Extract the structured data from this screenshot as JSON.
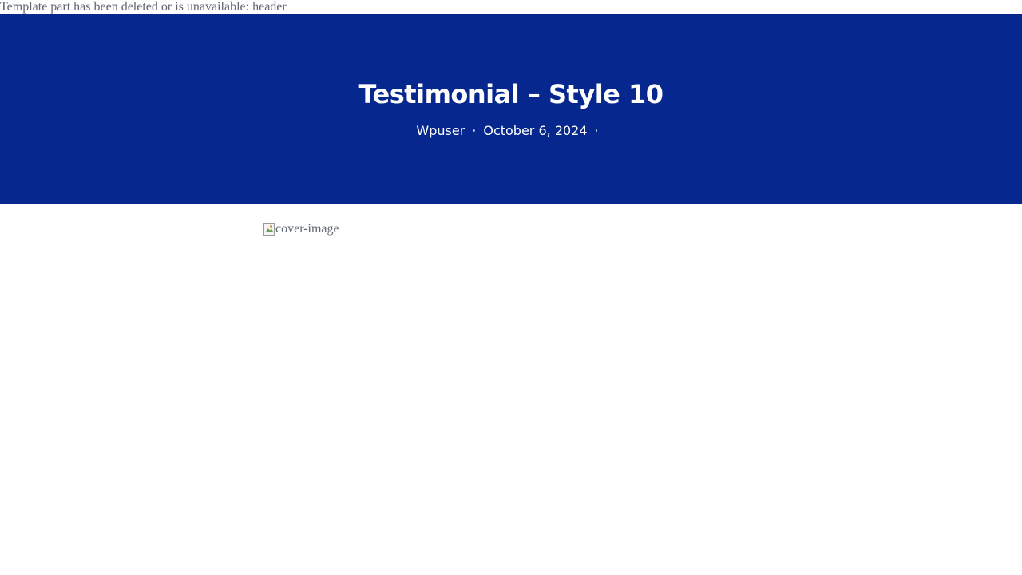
{
  "notice": {
    "text": "Template part has been deleted or is unavailable: header"
  },
  "hero": {
    "title": "Testimonial – Style 10",
    "author": "Wpuser",
    "separator": "·",
    "date": "October 6, 2024",
    "background_color": "#06278e"
  },
  "content": {
    "cover_image_alt": "cover-image",
    "cover_icon": "broken-image-icon"
  }
}
